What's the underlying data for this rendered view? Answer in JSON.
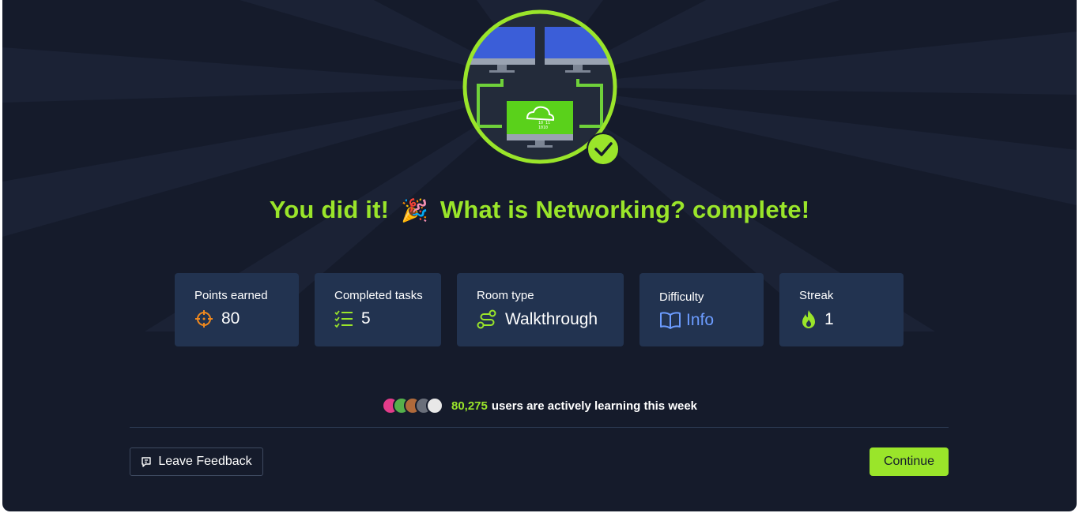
{
  "headline": {
    "prefix": "You did it!",
    "emoji": "🎉",
    "suffix": "What is Networking? complete!"
  },
  "stats": [
    {
      "label": "Points earned",
      "value": "80",
      "icon": "crosshair-icon"
    },
    {
      "label": "Completed tasks",
      "value": "5",
      "icon": "checklist-icon"
    },
    {
      "label": "Room type",
      "value": "Walkthrough",
      "icon": "route-icon"
    },
    {
      "label": "Difficulty",
      "value": "Info",
      "icon": "book-icon"
    },
    {
      "label": "Streak",
      "value": "1",
      "icon": "flame-icon"
    }
  ],
  "learners": {
    "count": "80,275",
    "text": "users are actively learning this week",
    "avatar_colors": [
      "#e23c8a",
      "#55b04b",
      "#b06a3b",
      "#6a6f7a",
      "#e8e8e8"
    ]
  },
  "buttons": {
    "feedback": "Leave Feedback",
    "continue": "Continue"
  },
  "colors": {
    "accent": "#9ae52a",
    "background": "#151b2b",
    "card": "#223350",
    "info": "#6c9cff",
    "points_icon": "#f0891e"
  }
}
